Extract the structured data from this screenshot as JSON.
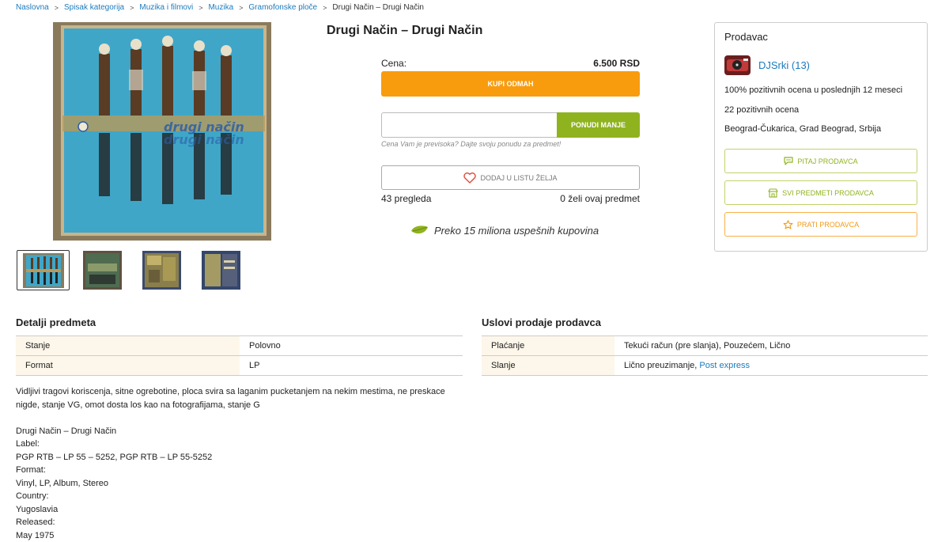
{
  "breadcrumb": {
    "items": [
      "Naslovna",
      "Spisak kategorija",
      "Muzika i filmovi",
      "Muzika",
      "Gramofonske ploče"
    ],
    "current": "Drugi Način – Drugi Način"
  },
  "product": {
    "title": "Drugi Način – Drugi Način",
    "price_label": "Cena:",
    "price_value": "6.500 RSD",
    "buy_label": "KUPI ODMAH",
    "offer_placeholder": "",
    "offer_label": "PONUDI MANJE",
    "offer_hint": "Cena Vam je previsoka? Dajte svoju ponudu za predmet!",
    "wishlist_label": "DODAJ U LISTU ŽELJA",
    "views": "43 pregleda",
    "wants": "0 želi ovaj predmet",
    "promo": "Preko 15 miliona uspešnih kupovina"
  },
  "seller": {
    "heading": "Prodavac",
    "name": "DJSrki (13)",
    "rating": "100% pozitivnih ocena u poslednjih 12 meseci",
    "positive": "22 pozitivnih ocena",
    "location": "Beograd-Čukarica, Grad Beograd, Srbija",
    "ask_label": "PITAJ PRODAVCA",
    "all_items_label": "SVI PREDMETI PRODAVCA",
    "follow_label": "PRATI PRODAVCA"
  },
  "details": {
    "title": "Detalji predmeta",
    "rows": [
      {
        "key": "Stanje",
        "value": "Polovno"
      },
      {
        "key": "Format",
        "value": "LP"
      }
    ]
  },
  "terms": {
    "title": "Uslovi prodaje prodavca",
    "rows": [
      {
        "key": "Plaćanje",
        "value": "Tekući račun (pre slanja), Pouzećem, Lično"
      },
      {
        "key": "Slanje",
        "value": "Lično preuzimanje, ",
        "link": "Post express"
      }
    ]
  },
  "description": {
    "paragraph": "Vidljivi tragovi koriscenja, sitne ogrebotine, ploca svira sa laganim pucketanjem na nekim mestima, ne preskace nigde, stanje VG, omot dosta los kao na fotografijama, stanje G",
    "lines": [
      "Drugi Način – Drugi Način",
      "Label:",
      "PGP RTB – LP 55 – 5252, PGP RTB – LP 55-5252",
      "Format:",
      "Vinyl, LP, Album, Stereo",
      "Country:",
      "Yugoslavia",
      "Released:",
      "May 1975"
    ]
  },
  "colors": {
    "accent_orange": "#f89c0e",
    "accent_green": "#8fb31f",
    "link_blue": "#1c7bbd"
  }
}
